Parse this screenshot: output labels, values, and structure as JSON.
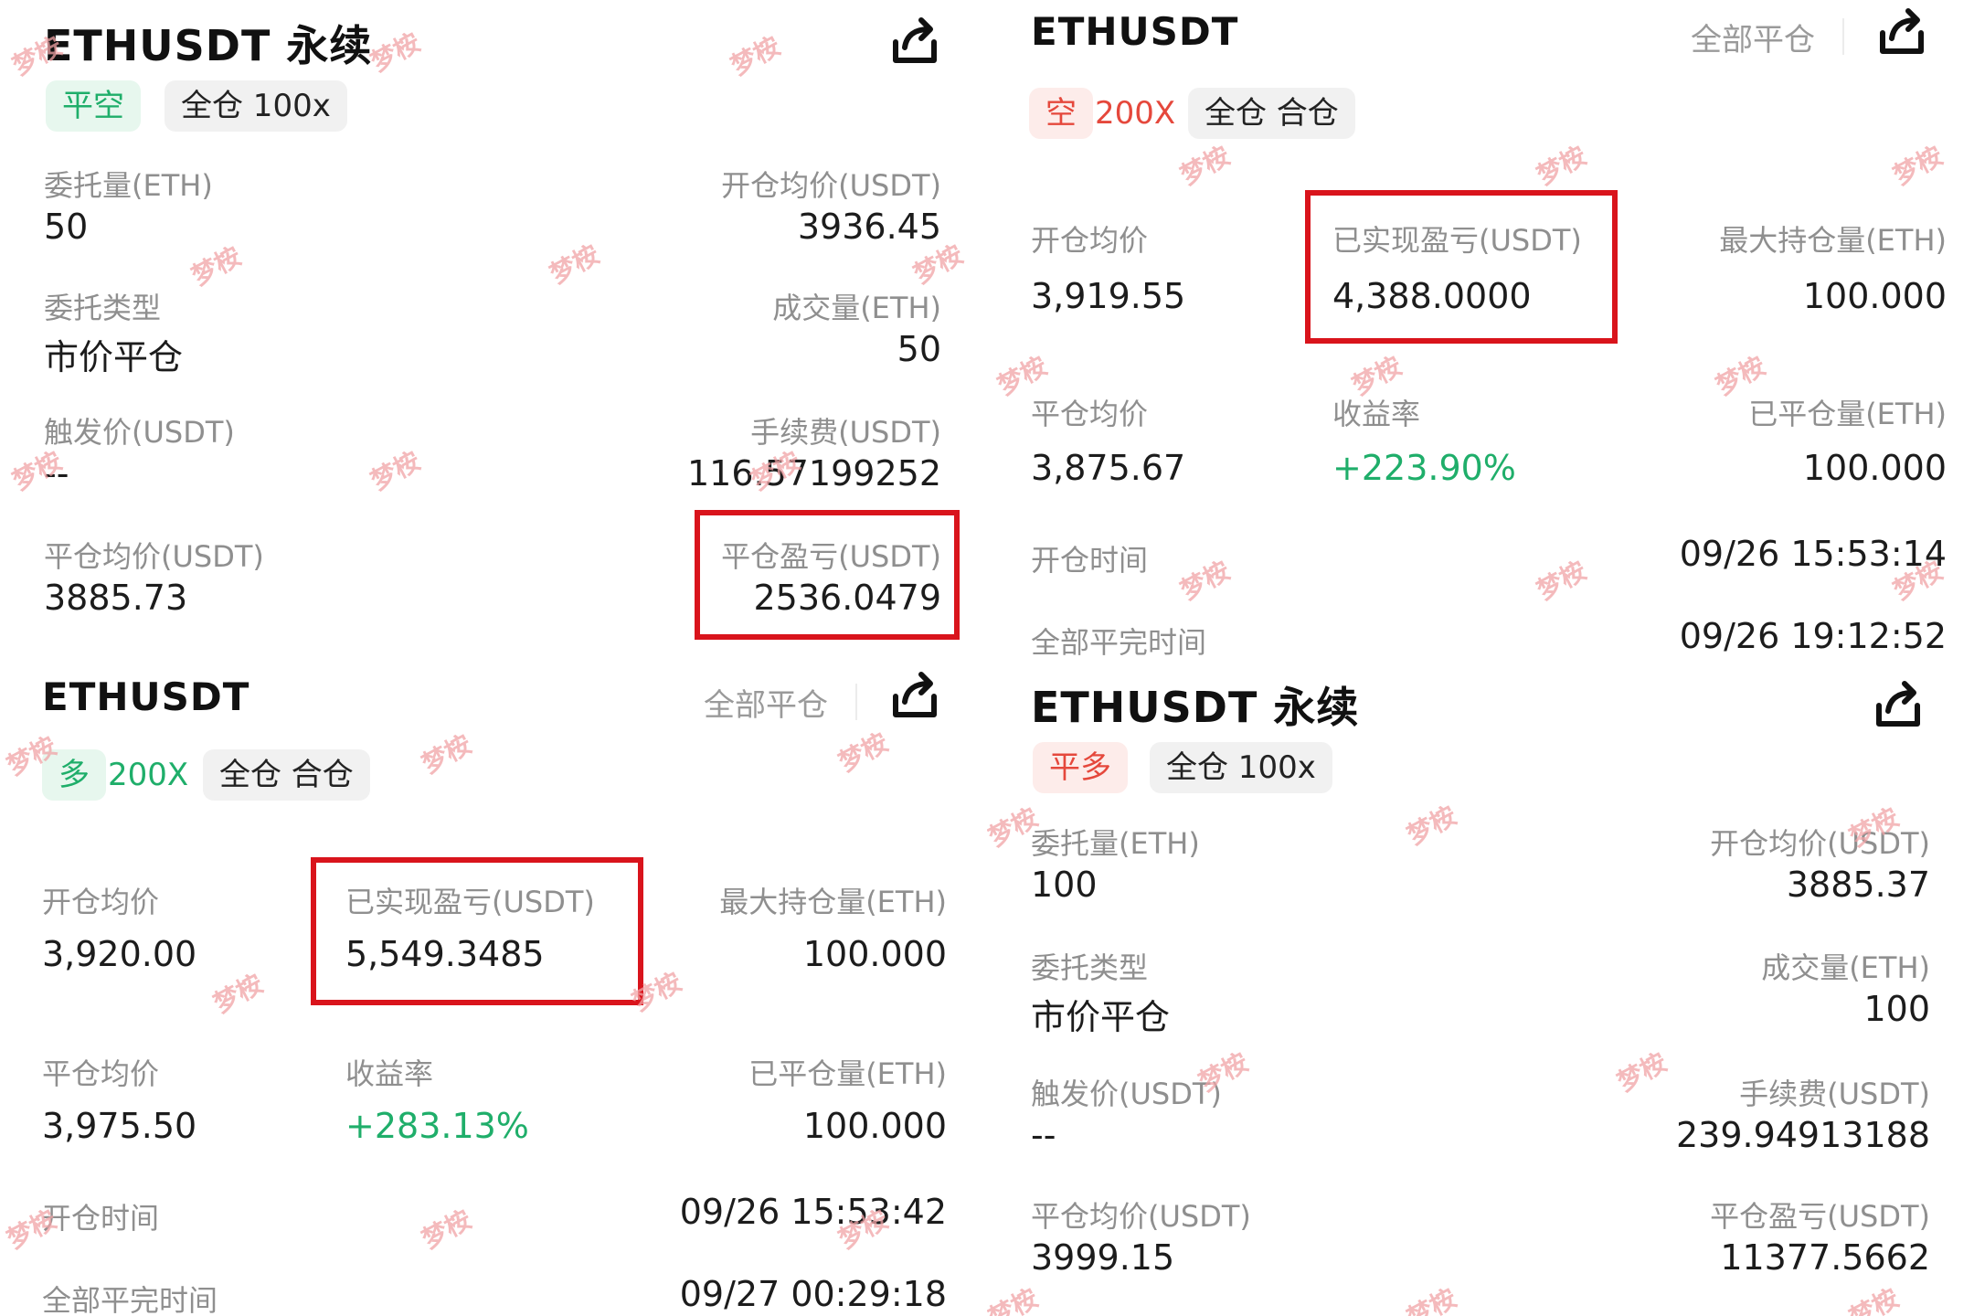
{
  "watermark": "梦桉",
  "colors": {
    "highlight": "#d9141c",
    "profit": "#1fae6a",
    "short": "#e5483c",
    "long": "#1fae6a"
  },
  "icons": {
    "share": "share-icon"
  },
  "top_left": {
    "title": "ETHUSDT 永续",
    "tags": [
      "平空",
      "全仓 100x"
    ],
    "rows": [
      {
        "l_label": "委托量(ETH)",
        "l_value": "50",
        "r_label": "开仓均价(USDT)",
        "r_value": "3936.45"
      },
      {
        "l_label": "委托类型",
        "l_value": "市价平仓",
        "r_label": "成交量(ETH)",
        "r_value": "50"
      },
      {
        "l_label": "触发价(USDT)",
        "l_value": "--",
        "r_label": "手续费(USDT)",
        "r_value": "116.57199252"
      },
      {
        "l_label": "平仓均价(USDT)",
        "l_value": "3885.73",
        "r_label": "平仓盈亏(USDT)",
        "r_value": "2536.0479"
      }
    ]
  },
  "top_right": {
    "title": "ETHUSDT",
    "close_all": "全部平仓",
    "tags": [
      "空",
      "200X",
      "全仓 合仓"
    ],
    "grid": [
      {
        "label": "开仓均价",
        "value": "3,919.55"
      },
      {
        "label": "已实现盈亏(USDT)",
        "value": "4,388.0000"
      },
      {
        "label": "最大持仓量(ETH)",
        "value": "100.000"
      },
      {
        "label": "平仓均价",
        "value": "3,875.67"
      },
      {
        "label": "收益率",
        "value": "+223.90%"
      },
      {
        "label": "已平仓量(ETH)",
        "value": "100.000"
      }
    ],
    "times": [
      {
        "label": "开仓时间",
        "value": "09/26 15:53:14"
      },
      {
        "label": "全部平完时间",
        "value": "09/26 19:12:52"
      }
    ]
  },
  "bottom_left": {
    "title": "ETHUSDT",
    "close_all": "全部平仓",
    "tags": [
      "多",
      "200X",
      "全仓 合仓"
    ],
    "grid": [
      {
        "label": "开仓均价",
        "value": "3,920.00"
      },
      {
        "label": "已实现盈亏(USDT)",
        "value": "5,549.3485"
      },
      {
        "label": "最大持仓量(ETH)",
        "value": "100.000"
      },
      {
        "label": "平仓均价",
        "value": "3,975.50"
      },
      {
        "label": "收益率",
        "value": "+283.13%"
      },
      {
        "label": "已平仓量(ETH)",
        "value": "100.000"
      }
    ],
    "times": [
      {
        "label": "开仓时间",
        "value": "09/26 15:53:42"
      },
      {
        "label": "全部平完时间",
        "value": "09/27 00:29:18"
      }
    ]
  },
  "bottom_right": {
    "title": "ETHUSDT 永续",
    "tags": [
      "平多",
      "全仓 100x"
    ],
    "rows": [
      {
        "l_label": "委托量(ETH)",
        "l_value": "100",
        "r_label": "开仓均价(USDT)",
        "r_value": "3885.37"
      },
      {
        "l_label": "委托类型",
        "l_value": "市价平仓",
        "r_label": "成交量(ETH)",
        "r_value": "100"
      },
      {
        "l_label": "触发价(USDT)",
        "l_value": "--",
        "r_label": "手续费(USDT)",
        "r_value": "239.94913188"
      },
      {
        "l_label": "平仓均价(USDT)",
        "l_value": "3999.15",
        "r_label": "平仓盈亏(USDT)",
        "r_value": "11377.5662"
      }
    ]
  }
}
